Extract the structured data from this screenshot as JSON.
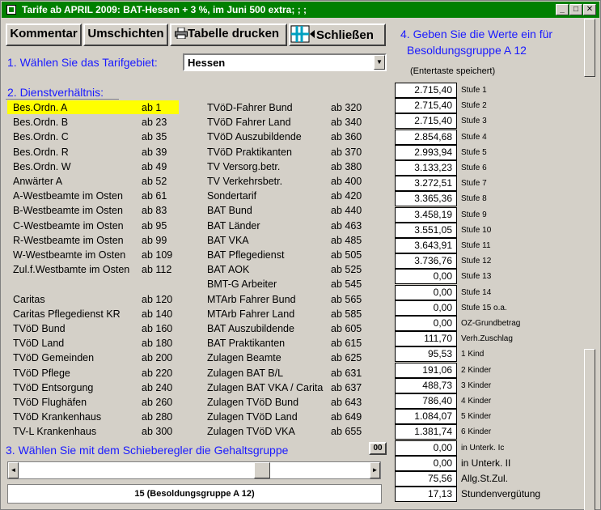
{
  "window": {
    "title": "Tarife ab APRIL 2009:  BAT-Hessen + 3 %, im Juni 500 extra; ; ;",
    "controls": [
      "_",
      "□",
      "✕"
    ]
  },
  "toolbar": {
    "kommentar": "Kommentar",
    "umschichten": "Umschichten",
    "drucken": "Tabelle drucken",
    "schliessen": "Schließen"
  },
  "step1": {
    "label": "1. Wählen Sie das Tarifgebiet:",
    "selected": "Hessen"
  },
  "step2": {
    "label": "2. Dienstverhältnis:"
  },
  "list_left": [
    {
      "name": "Bes.Ordn. A",
      "code": "ab 1"
    },
    {
      "name": "Bes.Ordn. B",
      "code": "ab 23"
    },
    {
      "name": "Bes.Ordn. C",
      "code": "ab 35"
    },
    {
      "name": "Bes.Ordn. R",
      "code": "ab 39"
    },
    {
      "name": "Bes.Ordn. W",
      "code": "ab 49"
    },
    {
      "name": "Anwärter A",
      "code": "ab 52"
    },
    {
      "name": "A-Westbeamte im Osten",
      "code": "ab 61"
    },
    {
      "name": "B-Westbeamte im Osten",
      "code": "ab 83"
    },
    {
      "name": "C-Westbeamte im Osten",
      "code": "ab 95"
    },
    {
      "name": "R-Westbeamte im Osten",
      "code": "ab 99"
    },
    {
      "name": "W-Westbeamte im Osten",
      "code": "ab 109"
    },
    {
      "name": "Zul.f.Westbamte im Osten",
      "code": "ab 112"
    },
    {
      "name": "",
      "code": ""
    },
    {
      "name": "Caritas",
      "code": "ab 120"
    },
    {
      "name": "Caritas Pflegedienst KR",
      "code": "ab 140"
    },
    {
      "name": "TVöD Bund",
      "code": "ab 160"
    },
    {
      "name": "TVöD Land",
      "code": "ab 180"
    },
    {
      "name": "TVöD Gemeinden",
      "code": "ab 200"
    },
    {
      "name": "TVöD Pflege",
      "code": "ab 220"
    },
    {
      "name": "TVöD Entsorgung",
      "code": "ab 240"
    },
    {
      "name": "TVöD Flughäfen",
      "code": "ab 260"
    },
    {
      "name": "TVöD Krankenhaus",
      "code": "ab 280"
    },
    {
      "name": "TV-L Krankenhaus",
      "code": "ab 300"
    }
  ],
  "list_right": [
    {
      "name": "TVöD-Fahrer Bund",
      "code": "ab 320"
    },
    {
      "name": "TVöD Fahrer Land",
      "code": "ab 340"
    },
    {
      "name": "TVöD Auszubildende",
      "code": "ab 360"
    },
    {
      "name": "TVöD Praktikanten",
      "code": "ab 370"
    },
    {
      "name": "TV Versorg.betr.",
      "code": "ab 380"
    },
    {
      "name": "TV Verkehrsbetr.",
      "code": "ab 400"
    },
    {
      "name": "Sondertarif",
      "code": "ab 420"
    },
    {
      "name": "BAT Bund",
      "code": "ab 440"
    },
    {
      "name": "BAT Länder",
      "code": "ab 463"
    },
    {
      "name": "BAT VKA",
      "code": "ab 485"
    },
    {
      "name": "BAT Pflegedienst",
      "code": "ab 505"
    },
    {
      "name": "BAT AOK",
      "code": "ab 525"
    },
    {
      "name": "BMT-G Arbeiter",
      "code": "ab 545"
    },
    {
      "name": "MTArb Fahrer Bund",
      "code": "ab 565"
    },
    {
      "name": "MTArb Fahrer Land",
      "code": "ab 585"
    },
    {
      "name": "BAT Auszubildende",
      "code": "ab 605"
    },
    {
      "name": "BAT Praktikanten",
      "code": "ab 615"
    },
    {
      "name": "Zulagen Beamte",
      "code": "ab 625"
    },
    {
      "name": "Zulagen BAT B/L",
      "code": "ab 631"
    },
    {
      "name": "Zulagen BAT VKA / Carita",
      "code": "ab 637"
    },
    {
      "name": "Zulagen TVöD Bund",
      "code": "ab 643"
    },
    {
      "name": "Zulagen TVöD Land",
      "code": "ab 649"
    },
    {
      "name": "Zulagen TVöD VKA",
      "code": "ab 655"
    }
  ],
  "step3": {
    "label": "3. Wählen Sie mit dem Schieberegler die Gehaltsgruppe",
    "button": "00",
    "info": "15  (Besoldungsgruppe A 12)"
  },
  "step4": {
    "label_line1": "4. Geben Sie die Werte ein für",
    "label_line2": "Besoldungsgruppe A 12",
    "hint": "(Entertaste speichert)"
  },
  "values": [
    {
      "value": "2.715,40",
      "label": "Stufe 1"
    },
    {
      "value": "2.715,40",
      "label": "Stufe 2"
    },
    {
      "value": "2.715,40",
      "label": "Stufe 3"
    },
    {
      "value": "2.854,68",
      "label": "Stufe 4"
    },
    {
      "value": "2.993,94",
      "label": "Stufe 5"
    },
    {
      "value": "3.133,23",
      "label": "Stufe 6"
    },
    {
      "value": "3.272,51",
      "label": "Stufe 7"
    },
    {
      "value": "3.365,36",
      "label": "Stufe 8"
    },
    {
      "value": "3.458,19",
      "label": "Stufe 9"
    },
    {
      "value": "3.551,05",
      "label": "Stufe 10"
    },
    {
      "value": "3.643,91",
      "label": "Stufe 11"
    },
    {
      "value": "3.736,76",
      "label": "Stufe 12"
    },
    {
      "value": "0,00",
      "label": "Stufe 13"
    },
    {
      "value": "0,00",
      "label": "Stufe 14"
    },
    {
      "value": "0,00",
      "label": "Stufe 15 o.a."
    },
    {
      "value": "0,00",
      "label": "OZ-Grundbetrag"
    },
    {
      "value": "111,70",
      "label": "Verh.Zuschlag"
    },
    {
      "value": "95,53",
      "label": "1 Kind"
    },
    {
      "value": "191,06",
      "label": "2 Kinder"
    },
    {
      "value": "488,73",
      "label": "3 Kinder"
    },
    {
      "value": "786,40",
      "label": "4 Kinder"
    },
    {
      "value": "1.084,07",
      "label": "5 Kinder"
    },
    {
      "value": "1.381,74",
      "label": "6 Kinder"
    },
    {
      "value": "0,00",
      "label": "in Unterk. Ic"
    },
    {
      "value": "0,00",
      "label": "in Unterk. II"
    },
    {
      "value": "75,56",
      "label": "Allg.St.Zul."
    },
    {
      "value": "17,13",
      "label": "Stundenvergütung"
    }
  ],
  "colors": {
    "titlebar": "#008000",
    "accent": "#1a1aff",
    "highlight": "#ffff00"
  }
}
